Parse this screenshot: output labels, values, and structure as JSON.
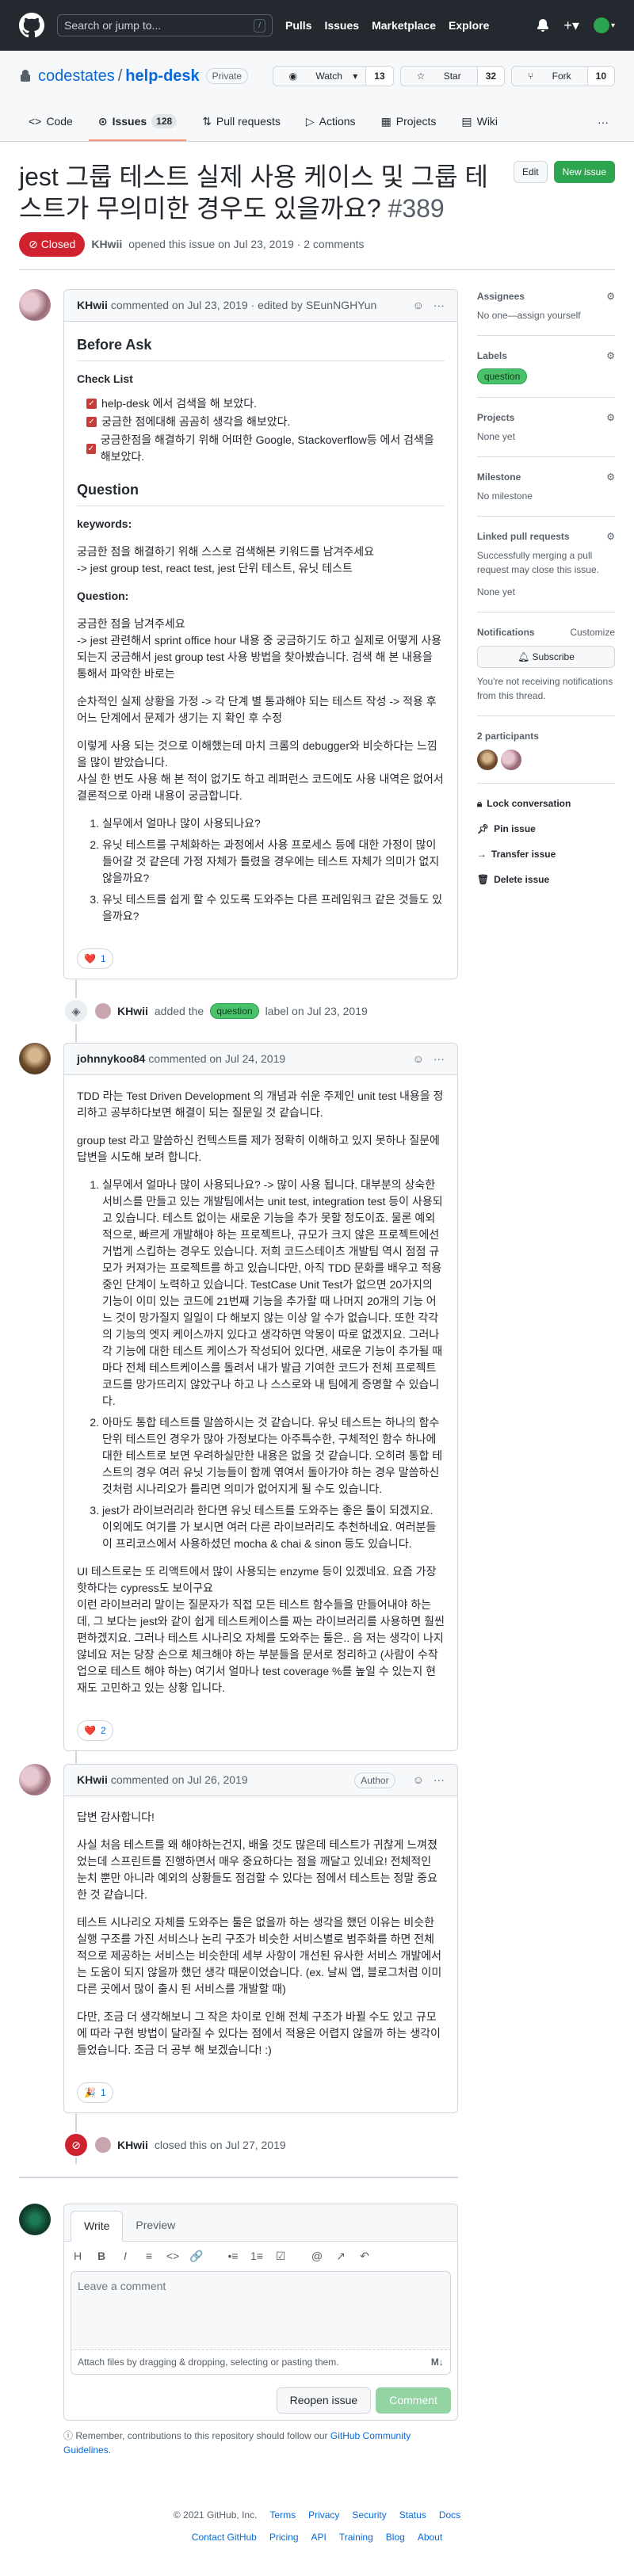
{
  "header": {
    "search_placeholder": "Search or jump to...",
    "search_key": "/",
    "nav": [
      "Pulls",
      "Issues",
      "Marketplace",
      "Explore"
    ]
  },
  "repo": {
    "owner": "codestates",
    "separator": "/",
    "name": "help-desk",
    "visibility": "Private",
    "watch_label": "Watch",
    "watch_count": "13",
    "star_label": "Star",
    "star_count": "32",
    "fork_label": "Fork",
    "fork_count": "10",
    "tabs": [
      {
        "label": "Code"
      },
      {
        "label": "Issues",
        "count": "128"
      },
      {
        "label": "Pull requests"
      },
      {
        "label": "Actions"
      },
      {
        "label": "Projects"
      },
      {
        "label": "Wiki"
      }
    ],
    "more": "···"
  },
  "issue": {
    "title": "jest 그룹 테스트 실제 사용 케이스 및 그룹 테스트가 무의미한 경우도 있을까요?",
    "number": "#389",
    "edit_label": "Edit",
    "new_issue_label": "New issue",
    "state": "Closed",
    "meta_author": "KHwii",
    "meta_text": "opened this issue on Jul 23, 2019 · 2 comments"
  },
  "comments": [
    {
      "author": "KHwii",
      "meta": "commented on Jul 23, 2019 · edited by SEunNGHYun",
      "before_ask": "Before Ask",
      "check_list": "Check List",
      "checks": [
        "help-desk 에서 검색을 해 보았다.",
        "궁금한 점에대해 곰곰히 생각을 해보았다.",
        "궁금한점을 해결하기 위해 어떠한 Google, Stackoverflow등 에서 검색을 해보았다."
      ],
      "question_h": "Question",
      "keywords_h": "keywords:",
      "keywords_p": "궁금한 점을 해결하기 위해 스스로 검색해본 키워드를 남겨주세요\n-> jest group test, react test, jest 단위 테스트, 유닛 테스트",
      "question_sub": "Question:",
      "q_p1": "궁금한 점을 남겨주세요\n-> jest 관련해서 sprint office hour 내용 중 궁금하기도 하고 실제로 어떻게 사용되는지 궁금해서 jest group test 사용 방법을 찾아봤습니다. 검색 해 본 내용을 통해서 파악한 바로는",
      "q_p2": "순차적인 실제 상황을 가정 -> 각 단계 별 통과해야 되는 테스트 작성 -> 적용 후 어느 단계에서 문제가 생기는 지 확인 후 수정",
      "q_p3": "이렇게 사용 되는 것으로 이해했는데 마치 크롬의 debugger와 비슷하다는 느낌을 많이 받았습니다.\n사실 한 번도 사용 해 본 적이 없기도 하고 레퍼런스 코드에도 사용 내역은 없어서 결론적으로 아래 내용이 궁금합니다.",
      "q_list": [
        "실무에서 얼마나 많이 사용되나요?",
        "유닛 테스트를 구체화하는 과정에서 사용 프로세스 등에 대한 가정이 많이 들어갈 것 같은데 가정 자체가 틀렸을 경우에는 테스트 자체가 의미가 없지 않을까요?",
        "유닛 테스트를 쉽게 할 수 있도록 도와주는 다른 프레임워크 같은 것들도 있을까요?"
      ],
      "reaction_emoji": "❤️",
      "reaction_count": "1"
    },
    {
      "author": "johnnykoo84",
      "meta": "commented on Jul 24, 2019",
      "p1": "TDD 라는 Test Driven Development 의 개념과 쉬운 주제인 unit test 내용을 정리하고 공부하다보면 해결이 되는 질문일 것 같습니다.",
      "p2": "group test 라고 말씀하신 컨텍스트를 제가 정확히 이해하고 있지 못하나 질문에 답변을 시도해 보려 합니다.",
      "list": [
        "실무에서 얼마나 많이 사용되나요? -> 많이 사용 됩니다. 대부분의 상숙한 서비스를 만들고 있는 개발팀에서는 unit test, integration test 등이 사용되고 있습니다. 테스트 없이는 새로운 기능을 추가 못할 정도이죠. 물론 예외적으로, 빠르게 개발해야 하는 프로젝트나, 규모가 크지 않은 프로젝트에선 거법게 스킵하는 경우도 있습니다. 저희 코드스테이츠 개발팀 역시 점점 규모가 커져가는 프로젝트를 하고 있습니다만, 아직 TDD 문화를 배우고 적용중인 단계이 노력하고 있습니다. TestCase Unit Test가 없으면 20가지의 기능이 이미 있는 코드에 21번째 기능을 추가할 때 나머지 20개의 기능 어느 것이 망가질지 일일이 다 해보지 않는 이상 알 수가 없습니다. 또한 각각의 기능의 엣지 케이스까지 있다고 생각하면 악몽이 따로 없겠지요. 그러나 각 기능에 대한 테스트 케이스가 작성되어 있다면, 새로운 기능이 추가될 때마다 전체 테스트케이스를 돌려서 내가 발급 기여한 코드가 전체 프로젝트 코드를 망가뜨리지 않았구나 하고 나 스스로와 내 팀에게 증명할 수 있습니다.",
        "아마도 통합 테스트를 말씀하시는 것 같습니다. 유닛 테스트는 하나의 함수 단위 테스트인 경우가 많아 가정보다는 아주특수한, 구체적인 함수 하나에 대한 테스트로 보면 우려하실만한 내용은 없을 것 같습니다. 오히려 통합 테스트의 경우 여러 유닛 기능들이 함께 엮여서 돌아가야 하는 경우 말씀하신 것처럼 시나리오가 틀리면 의미가 없어지게 될 수도 있습니다.",
        "jest가 라이브러리라 한다면 유닛 테스트를 도와주는 좋은 툴이 되겠지요. 이외에도 여기를 가 보시면 여러 다른 라이브러리도 추천하네요. 여러분들이 프리코스에서 사용하셨던 mocha & chai & sinon 등도 있습니다."
      ],
      "p3": "UI 테스트로는 또 리액트에서 많이 사용되는 enzyme 등이 있겠네요. 요즘 가장 핫하다는 cypress도 보이구요\n이런 라이브러리 말이는 질문자가 직접 모든 테스트 함수들을 만들어내야 하는데, 그 보다는 jest와 같이 쉽게 테스트케이스를 짜는 라이브러리를 사용하면 훨씬 편하겠지요. 그러나 테스트 시나리오 자체를 도와주는 툴은.. 음 저는 생각이 나지 않네요 저는 당장 손으로 체크해야 하는 부분들을 문서로 정리하고 (사람이 수작업으로 테스트 해야 하는) 여기서 얼마나 test coverage %를 높일 수 있는지 현재도 고민하고 있는 상황 입니다.",
      "reaction_emoji": "❤️",
      "reaction_count": "2"
    },
    {
      "author": "KHwii",
      "meta": "commented on Jul 26, 2019",
      "badge": "Author",
      "p1": "답변 감사합니다!",
      "p2": "사실 처음 테스트를 왜 해야하는건지, 배울 것도 많은데 테스트가 귀찮게 느껴졌었는데 스프린트를 진행하면서 매우 중요하다는 점을 깨달고 있네요! 전체적인 눈치 뿐만 아니라 예외의 상황들도 점검할 수 있다는 점에서 테스트는 정말 중요한 것 같습니다.",
      "p3": "테스트 시나리오 자체를 도와주는 툴은 없을까 하는 생각을 했던 이유는 비슷한 실행 구조를 가진 서비스나 논리 구조가 비슷한 서비스별로 범주화를 하면 전체적으로 제공하는 서비스는 비슷한데 세부 사항이 개선된 유사한 서비스 개발에서는 도움이 되지 않을까 했던 생각 때문이었습니다. (ex. 날씨 앱, 블로그처럼 이미 다른 곳에서 많이 출시 된 서비스를 개발할 때)",
      "p4": "다만, 조금 더 생각해보니 그 작은 차이로 인해 전체 구조가 바뀔 수도 있고 규모에 따라 구현 방법이 달라질 수 있다는 점에서 적용은 어렵지 않을까 하는 생각이 들었습니다. 조금 더 공부 해 보겠습니다! :)",
      "reaction_emoji": "🎉",
      "reaction_count": "1"
    }
  ],
  "events": {
    "label_event_author": "KHwii",
    "label_event_pre": "added the",
    "label_event_label": "question",
    "label_event_post": "label on Jul 23, 2019",
    "close_event_author": "KHwii",
    "close_event_post": "closed this on Jul 27, 2019"
  },
  "editor": {
    "tab_write": "Write",
    "tab_preview": "Preview",
    "tools": [
      "H",
      "B",
      "I",
      "≡",
      "<>",
      "🔗",
      "•≡",
      "1≡",
      "☑",
      "@",
      "↗",
      "↶"
    ],
    "placeholder": "Leave a comment",
    "attach_text": "Attach files by dragging & dropping, selecting or pasting them.",
    "md_icon": "M↓",
    "reopen_label": "Reopen issue",
    "comment_label": "Comment",
    "remember_pre": "Remember, contributions to this repository should follow our",
    "remember_link": "GitHub Community Guidelines",
    "remember_post": "."
  },
  "sidebar": {
    "assignees_h": "Assignees",
    "assignees_v": "No one—assign yourself",
    "labels_h": "Labels",
    "label": "question",
    "projects_h": "Projects",
    "projects_v": "None yet",
    "milestone_h": "Milestone",
    "milestone_v": "No milestone",
    "linked_h": "Linked pull requests",
    "linked_v": "Successfully merging a pull request may close this issue.",
    "linked_v2": "None yet",
    "notif_h": "Notifications",
    "notif_customize": "Customize",
    "subscribe": "Subscribe",
    "notif_v": "You're not receiving notifications from this thread.",
    "participants_h": "2 participants",
    "lock": "Lock conversation",
    "pin": "Pin issue",
    "transfer": "Transfer issue",
    "delete": "Delete issue"
  },
  "footer": {
    "copyright": "© 2021 GitHub, Inc.",
    "row1": [
      "Terms",
      "Privacy",
      "Security",
      "Status",
      "Docs"
    ],
    "row2": [
      "Contact GitHub",
      "Pricing",
      "API",
      "Training",
      "Blog",
      "About"
    ]
  },
  "colors": {
    "closed": "#cf222e",
    "label": "#4ac26b",
    "topbar": "#24292f"
  }
}
